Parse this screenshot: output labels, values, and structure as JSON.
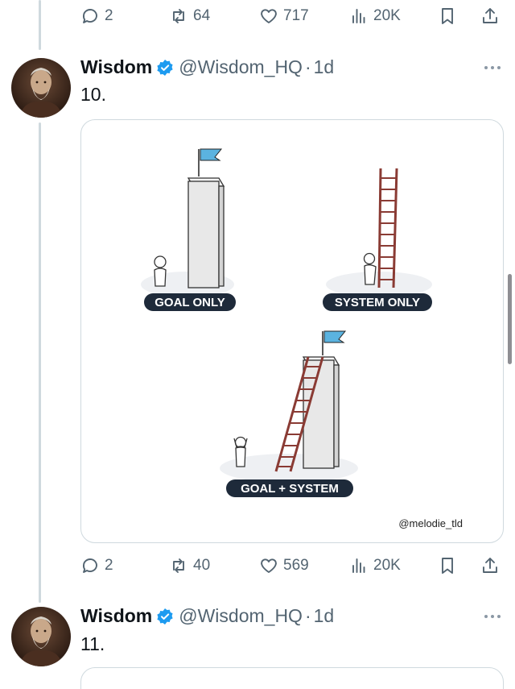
{
  "top_actions": {
    "replies": "2",
    "reposts": "64",
    "likes": "717",
    "views": "20K"
  },
  "tweet1": {
    "name": "Wisdom",
    "handle": "@Wisdom_HQ",
    "dot": "·",
    "time": "1d",
    "text": "10.",
    "image": {
      "panel1_label": "GOAL ONLY",
      "panel2_label": "SYSTEM ONLY",
      "panel3_label": "GOAL + SYSTEM",
      "credit": "@melodie_tld"
    },
    "actions": {
      "replies": "2",
      "reposts": "40",
      "likes": "569",
      "views": "20K"
    }
  },
  "tweet2": {
    "name": "Wisdom",
    "handle": "@Wisdom_HQ",
    "dot": "·",
    "time": "1d",
    "text": "11."
  },
  "colors": {
    "accent": "#1d9bf0",
    "muted": "#536471",
    "flag": "#5bb3e0",
    "ladder": "#8a3b34",
    "label_bg": "#1e2a3a"
  }
}
